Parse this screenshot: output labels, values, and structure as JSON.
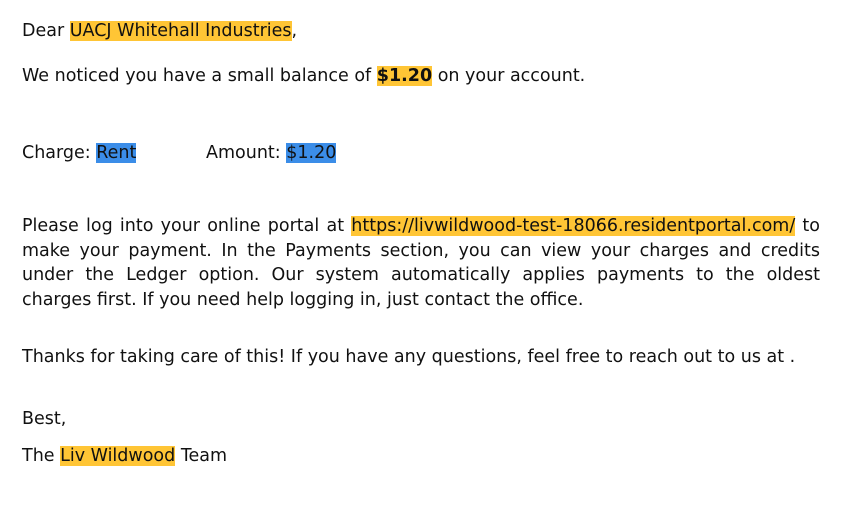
{
  "greeting": {
    "prefix": "Dear ",
    "recipient": "UACJ Whitehall Industries",
    "suffix": ","
  },
  "balance_line": {
    "prefix": "We noticed you have a small balance of ",
    "amount": "$1.20",
    "suffix": " on your account."
  },
  "charge_line": {
    "charge_label": "Charge: ",
    "charge_value": "Rent",
    "amount_label": "Amount: ",
    "amount_value": "$1.20"
  },
  "portal_paragraph": {
    "prefix": "Please log into your online portal at ",
    "link": "https://livwildwood-test-18066.residentportal.com/",
    "suffix": " to make your payment. In the Payments section, you can view your charges and credits under the Ledger option. Our system automatically applies payments to the oldest charges first. If you need help logging in, just contact the office."
  },
  "thanks_paragraph": "Thanks for taking care of this! If you have any questions, feel free to reach out to us at .",
  "closing": "Best,",
  "signature": {
    "prefix": "The ",
    "company": "Liv Wildwood",
    "suffix": " Team"
  },
  "colors": {
    "highlight_yellow": "#ffc535",
    "highlight_blue": "#3b8de8"
  }
}
